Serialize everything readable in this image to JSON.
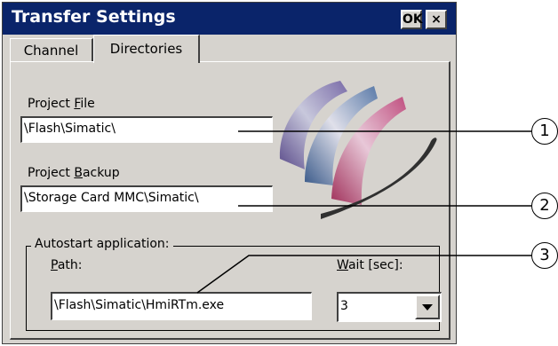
{
  "window": {
    "title": "Transfer Settings",
    "ok_label": "OK",
    "close_label": "×"
  },
  "tabs": [
    {
      "label": "Channel"
    },
    {
      "label": "Directories"
    }
  ],
  "project_file": {
    "label_pre": "Project ",
    "label_key": "F",
    "label_post": "ile",
    "value": "\\Flash\\Simatic\\"
  },
  "project_backup": {
    "label_pre": "Project ",
    "label_key": "B",
    "label_post": "ackup",
    "value": "\\Storage Card MMC\\Simatic\\"
  },
  "autostart": {
    "group_title": "Autostart application:",
    "path_label_key": "P",
    "path_label_post": "ath:",
    "path_value": "\\Flash\\Simatic\\HmiRTm.exe",
    "wait_label_key": "W",
    "wait_label_post": "ait [sec]:",
    "wait_value": "3"
  },
  "callouts": [
    "1",
    "2",
    "3"
  ],
  "colors": {
    "titlebar": "#0a246a",
    "dialog_bg": "#d6d3ce"
  }
}
